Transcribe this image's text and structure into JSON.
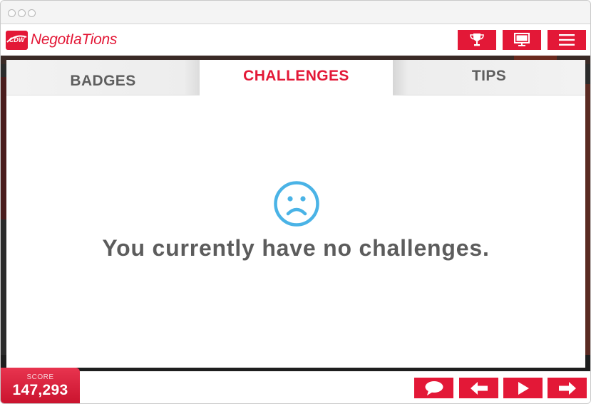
{
  "window": {
    "controls": [
      "close",
      "minimize",
      "maximize"
    ]
  },
  "header": {
    "logo_text": "CDW",
    "app_title": "NegotIaTions",
    "buttons": [
      {
        "icon": "trophy-icon"
      },
      {
        "icon": "monitor-icon"
      },
      {
        "icon": "menu-icon"
      }
    ]
  },
  "tabs": {
    "badges": "BADGES",
    "challenges": "CHALLENGES",
    "tips": "TIPS",
    "active": "challenges"
  },
  "main": {
    "empty_icon": "sad-face-icon",
    "empty_message": "You currently have no challenges."
  },
  "footer": {
    "score_label": "SCORE",
    "score_value": "147,293",
    "buttons": [
      {
        "icon": "speech-bubble-icon"
      },
      {
        "icon": "arrow-left-icon"
      },
      {
        "icon": "play-icon"
      },
      {
        "icon": "arrow-right-icon"
      }
    ]
  },
  "colors": {
    "brand_red": "#e31837",
    "tab_text": "#5e5e5e",
    "message_text": "#5c5c5c",
    "sad_icon": "#4ab3e6"
  }
}
